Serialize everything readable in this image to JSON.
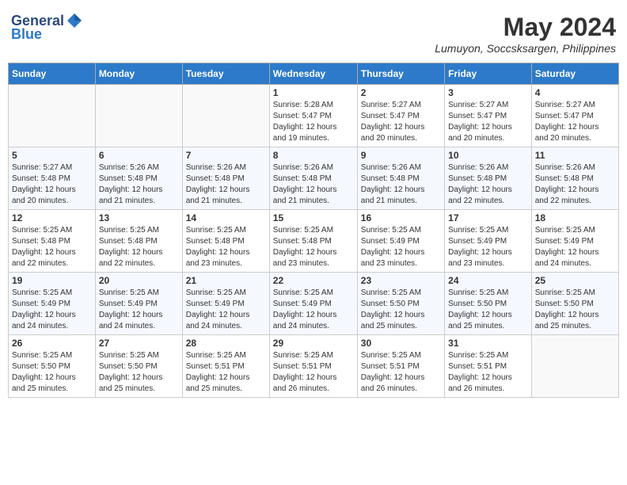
{
  "header": {
    "logo_general": "General",
    "logo_blue": "Blue",
    "title": "May 2024",
    "location": "Lumuyon, Soccsksargen, Philippines"
  },
  "weekdays": [
    "Sunday",
    "Monday",
    "Tuesday",
    "Wednesday",
    "Thursday",
    "Friday",
    "Saturday"
  ],
  "weeks": [
    [
      {
        "day": "",
        "info": ""
      },
      {
        "day": "",
        "info": ""
      },
      {
        "day": "",
        "info": ""
      },
      {
        "day": "1",
        "info": "Sunrise: 5:28 AM\nSunset: 5:47 PM\nDaylight: 12 hours\nand 19 minutes."
      },
      {
        "day": "2",
        "info": "Sunrise: 5:27 AM\nSunset: 5:47 PM\nDaylight: 12 hours\nand 20 minutes."
      },
      {
        "day": "3",
        "info": "Sunrise: 5:27 AM\nSunset: 5:47 PM\nDaylight: 12 hours\nand 20 minutes."
      },
      {
        "day": "4",
        "info": "Sunrise: 5:27 AM\nSunset: 5:47 PM\nDaylight: 12 hours\nand 20 minutes."
      }
    ],
    [
      {
        "day": "5",
        "info": "Sunrise: 5:27 AM\nSunset: 5:48 PM\nDaylight: 12 hours\nand 20 minutes."
      },
      {
        "day": "6",
        "info": "Sunrise: 5:26 AM\nSunset: 5:48 PM\nDaylight: 12 hours\nand 21 minutes."
      },
      {
        "day": "7",
        "info": "Sunrise: 5:26 AM\nSunset: 5:48 PM\nDaylight: 12 hours\nand 21 minutes."
      },
      {
        "day": "8",
        "info": "Sunrise: 5:26 AM\nSunset: 5:48 PM\nDaylight: 12 hours\nand 21 minutes."
      },
      {
        "day": "9",
        "info": "Sunrise: 5:26 AM\nSunset: 5:48 PM\nDaylight: 12 hours\nand 21 minutes."
      },
      {
        "day": "10",
        "info": "Sunrise: 5:26 AM\nSunset: 5:48 PM\nDaylight: 12 hours\nand 22 minutes."
      },
      {
        "day": "11",
        "info": "Sunrise: 5:26 AM\nSunset: 5:48 PM\nDaylight: 12 hours\nand 22 minutes."
      }
    ],
    [
      {
        "day": "12",
        "info": "Sunrise: 5:25 AM\nSunset: 5:48 PM\nDaylight: 12 hours\nand 22 minutes."
      },
      {
        "day": "13",
        "info": "Sunrise: 5:25 AM\nSunset: 5:48 PM\nDaylight: 12 hours\nand 22 minutes."
      },
      {
        "day": "14",
        "info": "Sunrise: 5:25 AM\nSunset: 5:48 PM\nDaylight: 12 hours\nand 23 minutes."
      },
      {
        "day": "15",
        "info": "Sunrise: 5:25 AM\nSunset: 5:48 PM\nDaylight: 12 hours\nand 23 minutes."
      },
      {
        "day": "16",
        "info": "Sunrise: 5:25 AM\nSunset: 5:49 PM\nDaylight: 12 hours\nand 23 minutes."
      },
      {
        "day": "17",
        "info": "Sunrise: 5:25 AM\nSunset: 5:49 PM\nDaylight: 12 hours\nand 23 minutes."
      },
      {
        "day": "18",
        "info": "Sunrise: 5:25 AM\nSunset: 5:49 PM\nDaylight: 12 hours\nand 24 minutes."
      }
    ],
    [
      {
        "day": "19",
        "info": "Sunrise: 5:25 AM\nSunset: 5:49 PM\nDaylight: 12 hours\nand 24 minutes."
      },
      {
        "day": "20",
        "info": "Sunrise: 5:25 AM\nSunset: 5:49 PM\nDaylight: 12 hours\nand 24 minutes."
      },
      {
        "day": "21",
        "info": "Sunrise: 5:25 AM\nSunset: 5:49 PM\nDaylight: 12 hours\nand 24 minutes."
      },
      {
        "day": "22",
        "info": "Sunrise: 5:25 AM\nSunset: 5:49 PM\nDaylight: 12 hours\nand 24 minutes."
      },
      {
        "day": "23",
        "info": "Sunrise: 5:25 AM\nSunset: 5:50 PM\nDaylight: 12 hours\nand 25 minutes."
      },
      {
        "day": "24",
        "info": "Sunrise: 5:25 AM\nSunset: 5:50 PM\nDaylight: 12 hours\nand 25 minutes."
      },
      {
        "day": "25",
        "info": "Sunrise: 5:25 AM\nSunset: 5:50 PM\nDaylight: 12 hours\nand 25 minutes."
      }
    ],
    [
      {
        "day": "26",
        "info": "Sunrise: 5:25 AM\nSunset: 5:50 PM\nDaylight: 12 hours\nand 25 minutes."
      },
      {
        "day": "27",
        "info": "Sunrise: 5:25 AM\nSunset: 5:50 PM\nDaylight: 12 hours\nand 25 minutes."
      },
      {
        "day": "28",
        "info": "Sunrise: 5:25 AM\nSunset: 5:51 PM\nDaylight: 12 hours\nand 25 minutes."
      },
      {
        "day": "29",
        "info": "Sunrise: 5:25 AM\nSunset: 5:51 PM\nDaylight: 12 hours\nand 26 minutes."
      },
      {
        "day": "30",
        "info": "Sunrise: 5:25 AM\nSunset: 5:51 PM\nDaylight: 12 hours\nand 26 minutes."
      },
      {
        "day": "31",
        "info": "Sunrise: 5:25 AM\nSunset: 5:51 PM\nDaylight: 12 hours\nand 26 minutes."
      },
      {
        "day": "",
        "info": ""
      }
    ]
  ]
}
